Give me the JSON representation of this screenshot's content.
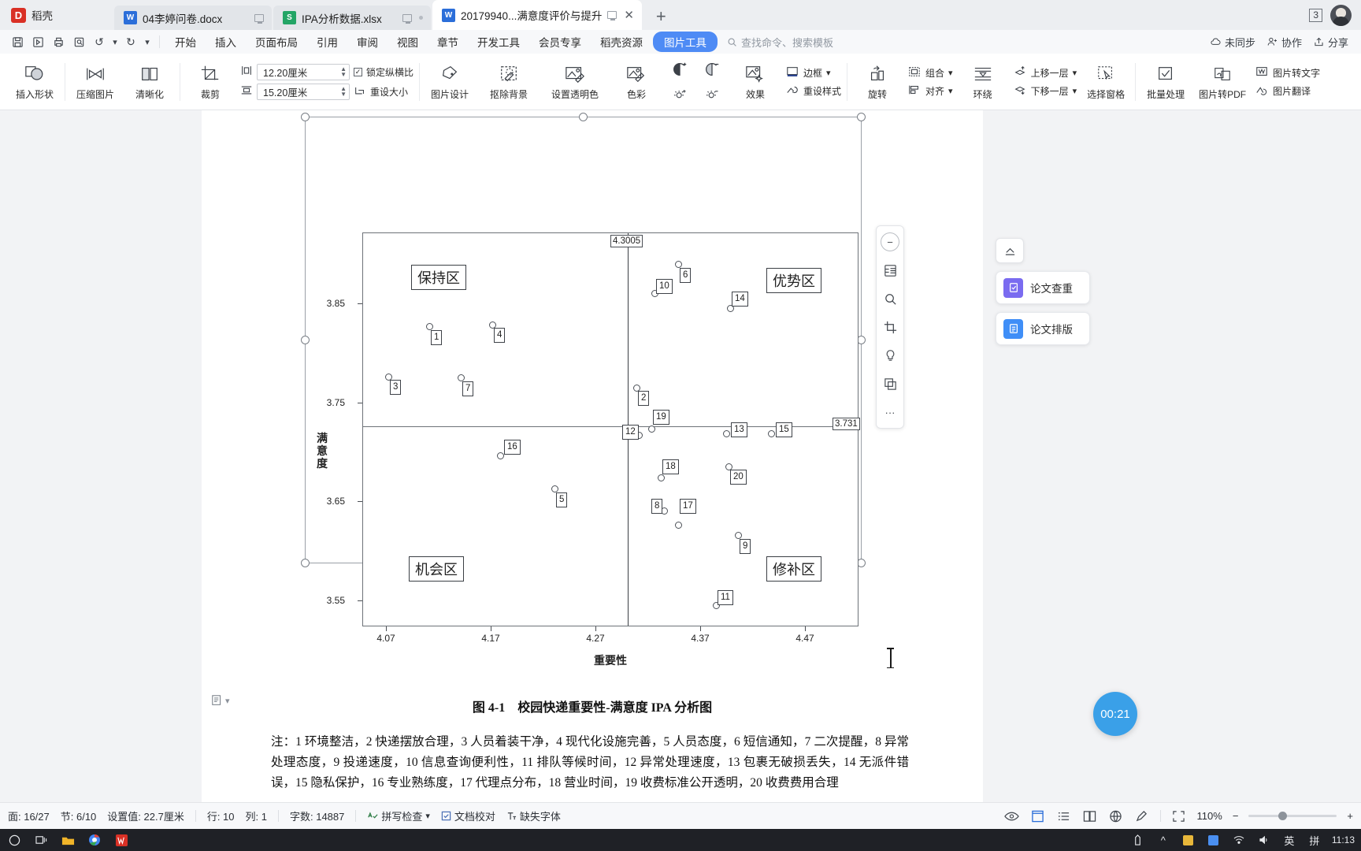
{
  "window": {
    "app_logo_text": "稻壳",
    "tabs": [
      {
        "label": "04李婷问卷.docx",
        "icon": "word-icon",
        "active": false
      },
      {
        "label": "IPA分析数据.xlsx",
        "icon": "excel-icon",
        "active": false
      },
      {
        "label": "20179940...满意度评价与提升",
        "icon": "word-icon",
        "active": true
      }
    ],
    "new_tab": "+",
    "tab_count_badge": "3",
    "close_glyph": "✕"
  },
  "menu": {
    "quick_icons": [
      "save-icon",
      "save-as-icon",
      "print-icon",
      "print-preview-icon",
      "undo-icon",
      "redo-icon",
      "customize-icon"
    ],
    "items": [
      "开始",
      "插入",
      "页面布局",
      "引用",
      "审阅",
      "视图",
      "章节",
      "开发工具",
      "会员专享",
      "稻壳资源"
    ],
    "active_tool_tab": "图片工具",
    "search_placeholder": "查找命令、搜索模板",
    "right_items": [
      "未同步",
      "协作",
      "分享"
    ]
  },
  "ribbon": {
    "insert_shape": "插入形状",
    "compress_image": "压缩图片",
    "sharpen": "清晰化",
    "crop": "裁剪",
    "width_value": "12.20厘米",
    "height_value": "15.20厘米",
    "lock_ratio": "锁定纵横比",
    "lock_ratio_checked": true,
    "reset_size": "重设大小",
    "picture_design": "图片设计",
    "remove_background": "抠除背景",
    "set_transparent_color": "设置透明色",
    "color": "色彩",
    "effects": "效果",
    "border": "边框",
    "reset_style": "重设样式",
    "rotate": "旋转",
    "align": "对齐",
    "group": "组合",
    "wrap": "环绕",
    "bring_forward": "上移一层",
    "send_backward": "下移一层",
    "selection_pane": "选择窗格",
    "batch_process": "批量处理",
    "image_to_pdf": "图片转PDF",
    "image_to_text": "图片转文字",
    "image_translate": "图片翻译"
  },
  "document": {
    "figure_caption": "图 4-1　校园快递重要性-满意度 IPA 分析图",
    "note": "注：1 环境整洁，2 快递摆放合理，3 人员着装干净，4 现代化设施完善，5 人员态度，6 短信通知，7 二次提醒，8 异常处理态度，9 投递速度，10 信息查询便利性，11 排队等候时间，12 异常处理速度，13 包裹无破损丢失，14 无派件错误，15 隐私保护，16 专业熟练度，17 代理点分布，18 营业时间，19 收费标准公开透明，20 收费费用合理"
  },
  "chart_data": {
    "type": "scatter",
    "title": "校园快递重要性-满意度 IPA 分析图",
    "xlabel": "重要性",
    "ylabel": "满意度",
    "xlim": [
      4.02,
      4.52
    ],
    "ylim": [
      3.515,
      3.895
    ],
    "xticks": [
      "4.07",
      "4.17",
      "4.27",
      "4.37",
      "4.47"
    ],
    "yticks": [
      "3.85",
      "3.75",
      "3.65",
      "3.55"
    ],
    "grid": false,
    "legend": "none",
    "crosshair": {
      "vertical_x": "4.3005",
      "horizontal_y": "3.731",
      "vertical_label": "4.3005",
      "horizontal_label": "3.731"
    },
    "quadrant_labels": [
      {
        "name": "保持区",
        "quadrant": "top-left"
      },
      {
        "name": "优势区",
        "quadrant": "top-right"
      },
      {
        "name": "机会区",
        "quadrant": "bottom-left"
      },
      {
        "name": "修补区",
        "quadrant": "bottom-right"
      }
    ],
    "points": [
      {
        "id": "1",
        "label": "环境整洁",
        "x": 4.137,
        "y": 3.822
      },
      {
        "id": "2",
        "label": "快递摆放合理",
        "x": 4.299,
        "y": 3.758
      },
      {
        "id": "3",
        "label": "人员着装干净",
        "x": 4.059,
        "y": 3.777
      },
      {
        "id": "4",
        "label": "现代化设施完善",
        "x": 4.2,
        "y": 3.824
      },
      {
        "id": "5",
        "label": "人员态度",
        "x": 4.233,
        "y": 3.673
      },
      {
        "id": "6",
        "label": "短信通知",
        "x": 4.342,
        "y": 3.869
      },
      {
        "id": "7",
        "label": "二次提醒",
        "x": 4.133,
        "y": 3.775
      },
      {
        "id": "8",
        "label": "异常处理态度",
        "x": 4.334,
        "y": 3.656
      },
      {
        "id": "9",
        "label": "投递速度",
        "x": 4.404,
        "y": 3.62
      },
      {
        "id": "10",
        "label": "信息查询便利性",
        "x": 4.327,
        "y": 3.852
      },
      {
        "id": "11",
        "label": "排队等候时间",
        "x": 4.387,
        "y": 3.551
      },
      {
        "id": "12",
        "label": "异常处理速度",
        "x": 4.314,
        "y": 3.726
      },
      {
        "id": "13",
        "label": "包裹无破损丢失",
        "x": 4.368,
        "y": 3.724
      },
      {
        "id": "14",
        "label": "无派件错误",
        "x": 4.391,
        "y": 3.841
      },
      {
        "id": "15",
        "label": "隐私保护",
        "x": 4.422,
        "y": 3.724
      },
      {
        "id": "16",
        "label": "专业熟练度",
        "x": 4.188,
        "y": 3.701
      },
      {
        "id": "17",
        "label": "代理点分布",
        "x": 4.344,
        "y": 3.648
      },
      {
        "id": "18",
        "label": "营业时间",
        "x": 4.324,
        "y": 3.694
      },
      {
        "id": "19",
        "label": "收费标准公开透明",
        "x": 4.308,
        "y": 3.735
      },
      {
        "id": "20",
        "label": "收费费用合理",
        "x": 4.365,
        "y": 3.688
      }
    ]
  },
  "right_panel": {
    "collapse_icon": "collapse-icon",
    "buttons": [
      {
        "label": "论文查重",
        "icon": "check-doc-icon",
        "color": "#7a6bf0"
      },
      {
        "label": "论文排版",
        "icon": "layout-doc-icon",
        "color": "#3f8ef7"
      }
    ],
    "image_tools": [
      "zoom-out-icon",
      "layers-icon",
      "magnifier-icon",
      "crop-icon",
      "idea-icon",
      "copy-icon",
      "more-icon"
    ],
    "timer": "00:21"
  },
  "statusbar": {
    "page": "面: 16/27",
    "section": "节: 6/10",
    "set_value": "设置值: 22.7厘米",
    "row": "行: 10",
    "col": "列: 1",
    "words": "字数: 14887",
    "spellcheck": "拼写检查",
    "doc_compare": "文档校对",
    "missing_font": "缺失字体",
    "zoom": "110%",
    "zoom_minus": "−",
    "zoom_plus": "+"
  },
  "taskbar": {
    "time": "11:13",
    "ime_lang": "英",
    "ime_mode": "拼"
  }
}
